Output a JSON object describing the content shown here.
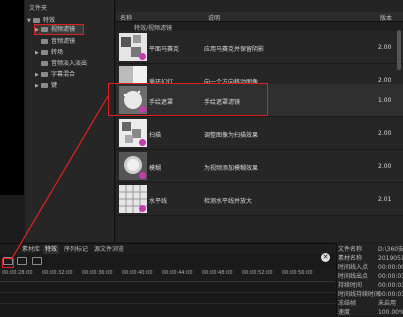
{
  "folder_pane": {
    "header": "文件夹",
    "items": [
      {
        "label": "特效",
        "arrow": "▼",
        "selected": false
      },
      {
        "label": "视频滤镜",
        "arrow": "▶",
        "selected": true
      },
      {
        "label": "音频滤镜",
        "arrow": "",
        "selected": false
      },
      {
        "label": "转场",
        "arrow": "▶",
        "selected": false
      },
      {
        "label": "音频淡入淡出",
        "arrow": "",
        "selected": false
      },
      {
        "label": "字幕混合",
        "arrow": "▶",
        "selected": false
      },
      {
        "label": "键",
        "arrow": "▶",
        "selected": false
      }
    ]
  },
  "list": {
    "columns": {
      "name": "名称",
      "desc": "说明",
      "version": "版本"
    },
    "path": "特效/视频滤镜",
    "rows": [
      {
        "name": "平面马赛克",
        "desc": "应用马赛克并保留阴影",
        "version": "2.00"
      },
      {
        "name": "循环幻灯",
        "desc": "向一个方向移动图像",
        "version": "2.00"
      },
      {
        "name": "手绘遮罩",
        "desc": "手绘遮罩滤镜",
        "version": "1.00"
      },
      {
        "name": "扫描",
        "desc": "调整图像为扫描效果",
        "version": "2.00"
      },
      {
        "name": "模糊",
        "desc": "为视频添加模糊效果",
        "version": "2.00"
      },
      {
        "name": "水平线",
        "desc": "检测水平线并放大",
        "version": "2.01"
      }
    ]
  },
  "bottom_tabs": [
    "素材库",
    "特效",
    "序列标记",
    "源文件浏览"
  ],
  "ruler_ticks": [
    "00:00:28:00",
    "00:00:32:00",
    "00:00:36:00",
    "00:00:40:00",
    "00:00:44:00",
    "00:00:48:00",
    "00:00:52:00",
    "00:00:56:00"
  ],
  "props": [
    {
      "k": "文件名称",
      "v": "D:\\360安全"
    },
    {
      "k": "素材名称",
      "v": "20190513_"
    },
    {
      "k": "时间线入点",
      "v": "00:00:00;"
    },
    {
      "k": "时间线出点",
      "v": "00:00:03;"
    },
    {
      "k": "持续时间",
      "v": "00:00:03;"
    },
    {
      "k": "时间线持续时间",
      "v": "00:00:03;"
    },
    {
      "k": "冻结帧",
      "v": "未启用"
    },
    {
      "k": "速度",
      "v": "100.00%"
    }
  ],
  "close_glyph": "✕",
  "colors": {
    "highlight": "#e02020",
    "badge": "#c43bb0"
  }
}
